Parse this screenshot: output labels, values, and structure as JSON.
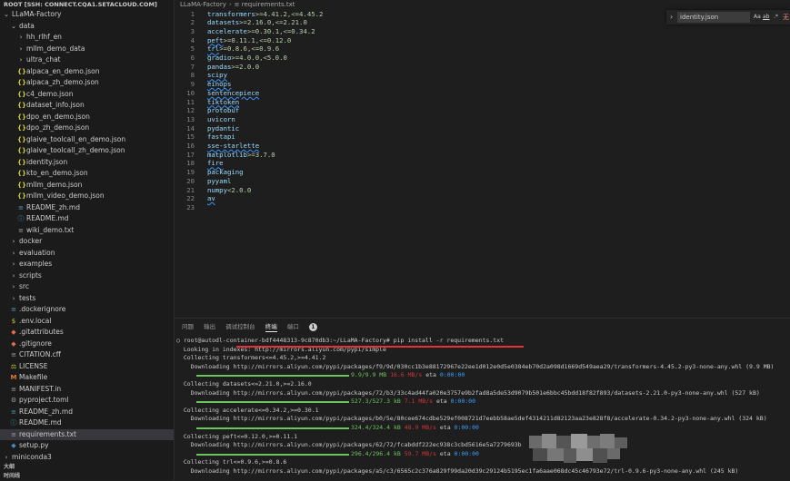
{
  "explorer": {
    "root_label": "ROOT [SSH: CONNECT.CQA1.SETACLOUD.COM]",
    "items": [
      {
        "label": "LLaMA-Factory",
        "icon": "chevron-down-icon",
        "kind": "folder",
        "depth": 0
      },
      {
        "label": "data",
        "icon": "chevron-down-icon",
        "kind": "folder",
        "depth": 1
      },
      {
        "label": "hh_rlhf_en",
        "icon": "chevron-right-icon",
        "kind": "folder",
        "depth": 2
      },
      {
        "label": "mllm_demo_data",
        "icon": "chevron-right-icon",
        "kind": "folder",
        "depth": 2
      },
      {
        "label": "ultra_chat",
        "icon": "chevron-right-icon",
        "kind": "folder",
        "depth": 2
      },
      {
        "label": "alpaca_en_demo.json",
        "icon": "json-file-icon",
        "kind": "json",
        "depth": 2
      },
      {
        "label": "alpaca_zh_demo.json",
        "icon": "json-file-icon",
        "kind": "json",
        "depth": 2
      },
      {
        "label": "c4_demo.json",
        "icon": "json-file-icon",
        "kind": "json",
        "depth": 2
      },
      {
        "label": "dataset_info.json",
        "icon": "json-file-icon",
        "kind": "json",
        "depth": 2
      },
      {
        "label": "dpo_en_demo.json",
        "icon": "json-file-icon",
        "kind": "json",
        "depth": 2
      },
      {
        "label": "dpo_zh_demo.json",
        "icon": "json-file-icon",
        "kind": "json",
        "depth": 2
      },
      {
        "label": "glaive_toolcall_en_demo.json",
        "icon": "json-file-icon",
        "kind": "json",
        "depth": 2
      },
      {
        "label": "glaive_toolcall_zh_demo.json",
        "icon": "json-file-icon",
        "kind": "json",
        "depth": 2
      },
      {
        "label": "identity.json",
        "icon": "json-file-icon",
        "kind": "json",
        "depth": 2
      },
      {
        "label": "kto_en_demo.json",
        "icon": "json-file-icon",
        "kind": "json",
        "depth": 2
      },
      {
        "label": "mllm_demo.json",
        "icon": "json-file-icon",
        "kind": "json",
        "depth": 2
      },
      {
        "label": "mllm_video_demo.json",
        "icon": "json-file-icon",
        "kind": "json",
        "depth": 2
      },
      {
        "label": "README_zh.md",
        "icon": "markdown-file-icon",
        "kind": "md",
        "depth": 2
      },
      {
        "label": "README.md",
        "icon": "info-file-icon",
        "kind": "info",
        "depth": 2
      },
      {
        "label": "wiki_demo.txt",
        "icon": "text-file-icon",
        "kind": "txt",
        "depth": 2
      },
      {
        "label": "docker",
        "icon": "chevron-right-icon",
        "kind": "folder",
        "depth": 1
      },
      {
        "label": "evaluation",
        "icon": "chevron-right-icon",
        "kind": "folder",
        "depth": 1
      },
      {
        "label": "examples",
        "icon": "chevron-right-icon",
        "kind": "folder",
        "depth": 1
      },
      {
        "label": "scripts",
        "icon": "chevron-right-icon",
        "kind": "folder",
        "depth": 1
      },
      {
        "label": "src",
        "icon": "chevron-right-icon",
        "kind": "folder",
        "depth": 1
      },
      {
        "label": "tests",
        "icon": "chevron-right-icon",
        "kind": "folder",
        "depth": 1
      },
      {
        "label": ".dockerignore",
        "icon": "docker-file-icon",
        "kind": "md",
        "depth": 1
      },
      {
        "label": ".env.local",
        "icon": "env-file-icon",
        "kind": "env",
        "depth": 1
      },
      {
        "label": ".gitattributes",
        "icon": "git-file-icon",
        "kind": "git",
        "depth": 1
      },
      {
        "label": ".gitignore",
        "icon": "git-file-icon",
        "kind": "git",
        "depth": 1
      },
      {
        "label": "CITATION.cff",
        "icon": "citation-file-icon",
        "kind": "cff",
        "depth": 1
      },
      {
        "label": "LICENSE",
        "icon": "license-file-icon",
        "kind": "lic",
        "depth": 1
      },
      {
        "label": "Makefile",
        "icon": "makefile-icon",
        "kind": "mk",
        "depth": 1
      },
      {
        "label": "MANIFEST.in",
        "icon": "manifest-file-icon",
        "kind": "txt",
        "depth": 1
      },
      {
        "label": "pyproject.toml",
        "icon": "toml-file-icon",
        "kind": "toml",
        "depth": 1
      },
      {
        "label": "README_zh.md",
        "icon": "markdown-file-icon",
        "kind": "md",
        "depth": 1
      },
      {
        "label": "README.md",
        "icon": "info-file-icon",
        "kind": "info",
        "depth": 1
      },
      {
        "label": "requirements.txt",
        "icon": "text-file-icon",
        "kind": "txt",
        "depth": 1,
        "selected": true
      },
      {
        "label": "setup.py",
        "icon": "python-file-icon",
        "kind": "py",
        "depth": 1
      },
      {
        "label": "miniconda3",
        "icon": "chevron-right-icon",
        "kind": "folder",
        "depth": 0
      }
    ],
    "outline_label": "大纲",
    "timeline_label": "时间线"
  },
  "breadcrumb": {
    "folder": "LLaMA-Factory",
    "file": "requirements.txt"
  },
  "editor": {
    "lines": [
      {
        "n": "1",
        "pkg": "transformers",
        "spec": ">=4.41.2,<=4.45.2"
      },
      {
        "n": "2",
        "pkg": "datasets",
        "spec": ">=2.16.0,<=2.21.0"
      },
      {
        "n": "3",
        "pkg": "accelerate",
        "spec": ">=0.30.1,<=0.34.2"
      },
      {
        "n": "4",
        "pkg": "peft",
        "spec": ">=0.11.1,<=0.12.0"
      },
      {
        "n": "5",
        "pkg": "trl",
        "spec": ">=0.8.6,<=0.9.6"
      },
      {
        "n": "6",
        "pkg": "gradio",
        "spec": ">=4.0.0,<5.0.0"
      },
      {
        "n": "7",
        "pkg": "pandas",
        "spec": ">=2.0.0"
      },
      {
        "n": "8",
        "pkg": "scipy",
        "spec": ""
      },
      {
        "n": "9",
        "pkg": "einops",
        "spec": ""
      },
      {
        "n": "10",
        "pkg": "sentencepiece",
        "spec": ""
      },
      {
        "n": "11",
        "pkg": "tiktoken",
        "spec": ""
      },
      {
        "n": "12",
        "pkg": "protobuf",
        "spec": ""
      },
      {
        "n": "13",
        "pkg": "uvicorn",
        "spec": ""
      },
      {
        "n": "14",
        "pkg": "pydantic",
        "spec": ""
      },
      {
        "n": "15",
        "pkg": "fastapi",
        "spec": ""
      },
      {
        "n": "16",
        "pkg": "sse-starlette",
        "spec": ""
      },
      {
        "n": "17",
        "pkg": "matplotlib",
        "spec": ">=3.7.0"
      },
      {
        "n": "18",
        "pkg": "fire",
        "spec": ""
      },
      {
        "n": "19",
        "pkg": "packaging",
        "spec": ""
      },
      {
        "n": "20",
        "pkg": "pyyaml",
        "spec": ""
      },
      {
        "n": "21",
        "pkg": "numpy",
        "spec": "<2.0.0"
      },
      {
        "n": "22",
        "pkg": "av",
        "spec": ""
      },
      {
        "n": "23",
        "pkg": "",
        "spec": ""
      }
    ]
  },
  "find": {
    "value": "identity.json",
    "case_label": "Aa",
    "word_label": "ab",
    "regex_label": ".*",
    "no_results": "无"
  },
  "panel": {
    "tabs": [
      {
        "label": "问题",
        "active": false
      },
      {
        "label": "输出",
        "active": false
      },
      {
        "label": "调试控制台",
        "active": false
      },
      {
        "label": "终端",
        "active": true
      },
      {
        "label": "端口",
        "active": false
      }
    ],
    "ports_badge": "1"
  },
  "terminal": {
    "lines": [
      {
        "type": "text",
        "text": "○ root@autodl-container-bdf4448313-9c870db3:~/LLaMA-Factory# pip install -r requirements.txt"
      },
      {
        "type": "text",
        "text": "  Looking in indexes: http://mirrors.aliyun.com/pypi/simple"
      },
      {
        "type": "text",
        "text": "  Collecting transformers<=4.45.2,>=4.41.2"
      },
      {
        "type": "text",
        "text": "    Downloading http://mirrors.aliyun.com/pypi/packages/f9/9d/030cc1b3e88172967e22ee1d012e0d5e0384eb70d2a098d1669d549aea29/transformers-4.45.2-py3-none-any.whl (9.9 MB)"
      },
      {
        "type": "progress",
        "size": "9.9/9.9 MB",
        "speed": "16.6 MB/s",
        "eta": "0:00:00"
      },
      {
        "type": "text",
        "text": "  Collecting datasets<=2.21.0,>=2.16.0"
      },
      {
        "type": "text",
        "text": "    Downloading http://mirrors.aliyun.com/pypi/packages/72/b3/33c4ad44fa020e3757e9b2fad8a5de53d9079b501e6bbc45bdd18f82f893/datasets-2.21.0-py3-none-any.whl (527 kB)"
      },
      {
        "type": "progress",
        "size": "527.3/527.3 kB",
        "speed": "7.1 MB/s",
        "eta": "0:00:00"
      },
      {
        "type": "text",
        "text": "  Collecting accelerate<=0.34.2,>=0.30.1"
      },
      {
        "type": "text",
        "text": "    Downloading http://mirrors.aliyun.com/pypi/packages/b0/5e/80cee674cdbe529ef008721d7eebb58ae5def4314211d82123aa23e828f8/accelerate-0.34.2-py3-none-any.whl (324 kB)"
      },
      {
        "type": "progress",
        "size": "324.4/324.4 kB",
        "speed": "48.9 MB/s",
        "eta": "0:00:00"
      },
      {
        "type": "text",
        "text": "  Collecting peft<=0.12.0,>=0.11.1"
      },
      {
        "type": "text",
        "text": "    Downloading http://mirrors.aliyun.com/pypi/packages/62/72/fcabddf222ec938c3cbd5616e5a7279693b"
      },
      {
        "type": "progress",
        "size": "296.4/296.4 kB",
        "speed": "59.7 MB/s",
        "eta": "0:00:00"
      },
      {
        "type": "text",
        "text": "  Collecting trl<=0.9.6,>=0.8.6"
      },
      {
        "type": "text",
        "text": "    Downloading http://mirrors.aliyun.com/pypi/packages/a5/c3/6565c2c376a829f99da20d39c29124b5195ec1fa6aae068dc45c46793e72/trl-0.9.6-py3-none-any.whl (245 kB)"
      }
    ]
  },
  "colors": {
    "accent": "#3794ff",
    "progress": "#6bc45d",
    "speed": "#d13438",
    "annotation": "#e8303a"
  }
}
